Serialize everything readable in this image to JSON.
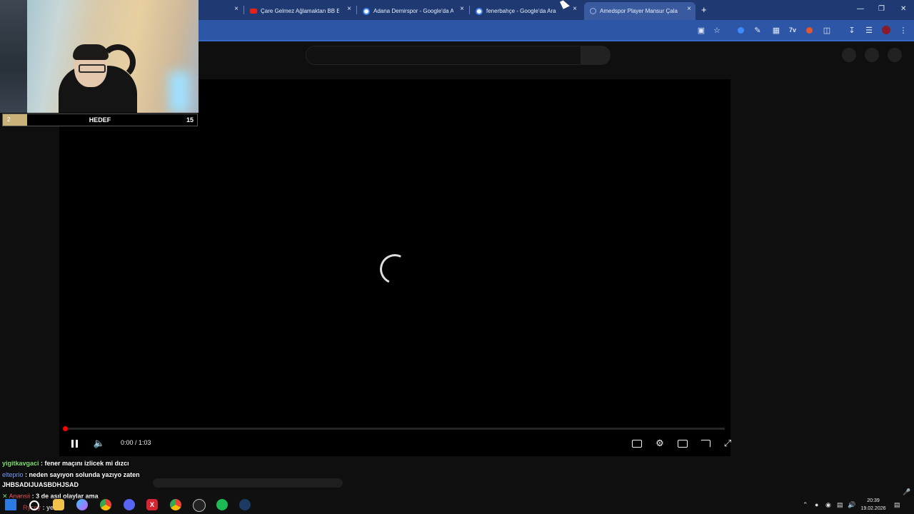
{
  "browser": {
    "tabs": [
      {
        "title": "",
        "favicon": "blank",
        "active": false
      },
      {
        "title": "Çare Gelmez Ağlamaktan BB Er",
        "favicon": "youtube-icon",
        "active": false
      },
      {
        "title": "Adana Demirspor - Google'da A",
        "favicon": "google-icon",
        "active": false
      },
      {
        "title": "fenerbahçe - Google'da Ara",
        "favicon": "google-icon",
        "active": false
      },
      {
        "title": "Amedspor Player Mansur Çala",
        "favicon": "loading-icon",
        "active": true
      }
    ],
    "new_tab_label": "+",
    "close_label": "×"
  },
  "player": {
    "time": "0:00 / 1:03",
    "progress_fraction": 0.0,
    "state": "loading"
  },
  "stream_overlay": {
    "goal": {
      "current": "2",
      "label": "HEDEF",
      "target": "15"
    },
    "chat": [
      {
        "user": "yigitkavgaci",
        "user_color": "#7ee06a",
        "message": "fener maçını izlicek mi dızcı"
      },
      {
        "user": "elteprio",
        "user_color": "#7aa2ff",
        "message": "neden sayıyon solunda yazıyo zaten"
      },
      {
        "user": "",
        "user_color": "#ffffff",
        "message": "JHBSADIJUASBDHJSAD"
      },
      {
        "user": "Anansii",
        "user_color": "#ff5a5a",
        "message": "3 de asıl olaylar ama"
      },
      {
        "user": "Rycey",
        "user_color": "#ff5a5a",
        "message": "yeah"
      }
    ]
  },
  "taskbar": {
    "clock_time": "20:39",
    "clock_date": "19.02.2026",
    "apps": [
      "windows-icon",
      "search-icon",
      "file-explorer-icon",
      "copilot-icon",
      "chrome-icon",
      "discord-icon",
      "xsplit-icon",
      "chrome-active-icon",
      "obs-icon",
      "spotify-icon",
      "steam-icon"
    ]
  },
  "colors": {
    "tabstrip": "#1f3a72",
    "toolbar": "#2d57a6",
    "progress": "#ff0000",
    "goal_fill": "#c9b27a"
  }
}
